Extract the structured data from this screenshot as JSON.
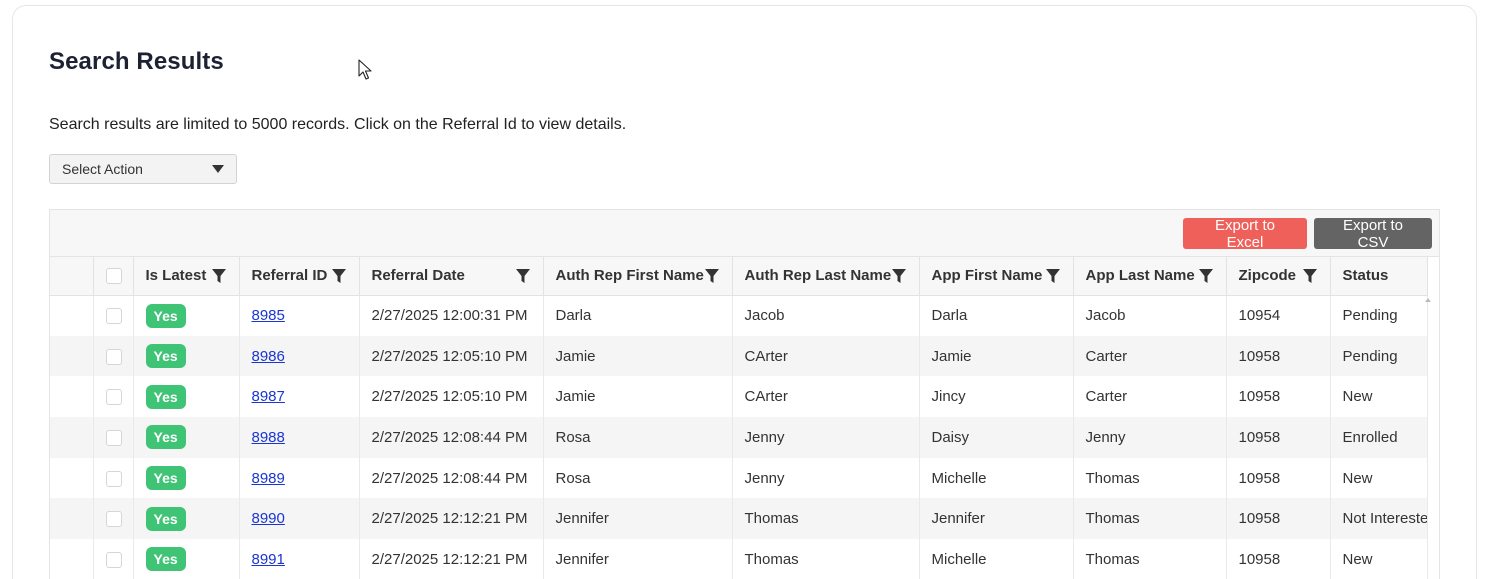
{
  "page": {
    "title": "Search Results",
    "subtitle": "Search results are limited to 5000 records. Click on the Referral Id to view details.",
    "select_action": {
      "value": "Select Action"
    }
  },
  "toolbar": {
    "export_excel": "Export to Excel",
    "export_csv": "Export to CSV"
  },
  "colors": {
    "excel_button": "#f0605a",
    "csv_button": "#646464",
    "badge_green": "#3fc374",
    "link_blue": "#1a35d4"
  },
  "table": {
    "columns": [
      "Is Latest",
      "Referral ID",
      "Referral Date",
      "Auth Rep First Name",
      "Auth Rep Last Name",
      "App First Name",
      "App Last Name",
      "Zipcode",
      "Status"
    ],
    "rows": [
      {
        "is_latest": "Yes",
        "referral_id": "8985",
        "referral_date": "2/27/2025 12:00:31 PM",
        "auth_first": "Darla",
        "auth_last": "Jacob",
        "app_first": "Darla",
        "app_last": "Jacob",
        "zipcode": "10954",
        "status": "Pending"
      },
      {
        "is_latest": "Yes",
        "referral_id": "8986",
        "referral_date": "2/27/2025 12:05:10 PM",
        "auth_first": "Jamie",
        "auth_last": "CArter",
        "app_first": "Jamie",
        "app_last": "Carter",
        "zipcode": "10958",
        "status": "Pending"
      },
      {
        "is_latest": "Yes",
        "referral_id": "8987",
        "referral_date": "2/27/2025 12:05:10 PM",
        "auth_first": "Jamie",
        "auth_last": "CArter",
        "app_first": "Jincy",
        "app_last": "Carter",
        "zipcode": "10958",
        "status": "New"
      },
      {
        "is_latest": "Yes",
        "referral_id": "8988",
        "referral_date": "2/27/2025 12:08:44 PM",
        "auth_first": "Rosa",
        "auth_last": "Jenny",
        "app_first": "Daisy",
        "app_last": "Jenny",
        "zipcode": "10958",
        "status": "Enrolled"
      },
      {
        "is_latest": "Yes",
        "referral_id": "8989",
        "referral_date": "2/27/2025 12:08:44 PM",
        "auth_first": "Rosa",
        "auth_last": "Jenny",
        "app_first": "Michelle",
        "app_last": "Thomas",
        "zipcode": "10958",
        "status": "New"
      },
      {
        "is_latest": "Yes",
        "referral_id": "8990",
        "referral_date": "2/27/2025 12:12:21 PM",
        "auth_first": "Jennifer",
        "auth_last": "Thomas",
        "app_first": "Jennifer",
        "app_last": "Thomas",
        "zipcode": "10958",
        "status": "Not Intereste"
      },
      {
        "is_latest": "Yes",
        "referral_id": "8991",
        "referral_date": "2/27/2025 12:12:21 PM",
        "auth_first": "Jennifer",
        "auth_last": "Thomas",
        "app_first": "Michelle",
        "app_last": "Thomas",
        "zipcode": "10958",
        "status": "New"
      }
    ]
  }
}
